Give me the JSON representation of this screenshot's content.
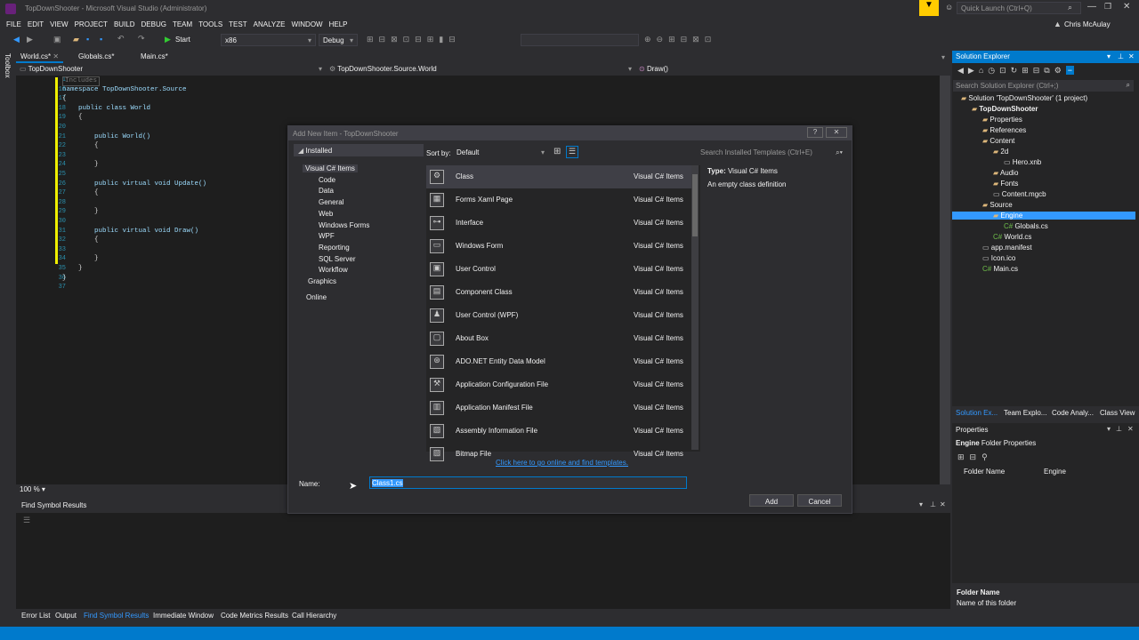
{
  "window": {
    "title": "TopDownShooter - Microsoft Visual Studio (Administrator)",
    "quick_launch": "Quick Launch (Ctrl+Q)",
    "user": "Chris McAulay"
  },
  "menu": [
    "FILE",
    "EDIT",
    "VIEW",
    "PROJECT",
    "BUILD",
    "DEBUG",
    "TEAM",
    "TOOLS",
    "TEST",
    "ANALYZE",
    "WINDOW",
    "HELP"
  ],
  "toolbar": {
    "start": "Start",
    "platform": "x86",
    "config": "Debug"
  },
  "editor": {
    "tabs": [
      "World.cs*",
      "Globals.cs*",
      "Main.cs*"
    ],
    "nav": {
      "project": "TopDownShooter",
      "class": "TopDownShooter.Source.World",
      "member": "Draw()"
    },
    "lines": [
      {
        "n": "1",
        "t": "Includes"
      },
      {
        "n": "16",
        "t": "namespace TopDownShooter.Source"
      },
      {
        "n": "17",
        "t": "{"
      },
      {
        "n": "18",
        "t": "    public class World"
      },
      {
        "n": "19",
        "t": "    {"
      },
      {
        "n": "20",
        "t": ""
      },
      {
        "n": "21",
        "t": "        public World()"
      },
      {
        "n": "22",
        "t": "        {"
      },
      {
        "n": "23",
        "t": ""
      },
      {
        "n": "24",
        "t": "        }"
      },
      {
        "n": "25",
        "t": ""
      },
      {
        "n": "26",
        "t": "        public virtual void Update()"
      },
      {
        "n": "27",
        "t": "        {"
      },
      {
        "n": "28",
        "t": ""
      },
      {
        "n": "29",
        "t": "        }"
      },
      {
        "n": "30",
        "t": ""
      },
      {
        "n": "31",
        "t": "        public virtual void Draw()"
      },
      {
        "n": "32",
        "t": "        {"
      },
      {
        "n": "33",
        "t": ""
      },
      {
        "n": "34",
        "t": "        }"
      },
      {
        "n": "35",
        "t": "    }"
      },
      {
        "n": "36",
        "t": "}"
      },
      {
        "n": "37",
        "t": ""
      }
    ],
    "zoom": "100 %"
  },
  "find_results": {
    "title": "Find Symbol Results"
  },
  "bottom_tabs": [
    "Error List",
    "Output",
    "Find Symbol Results",
    "Immediate Window",
    "Code Metrics Results",
    "Call Hierarchy"
  ],
  "solution_explorer": {
    "title": "Solution Explorer",
    "search": "Search Solution Explorer (Ctrl+;)",
    "items": [
      {
        "label": "Solution 'TopDownShooter' (1 project)",
        "indent": 0
      },
      {
        "label": "TopDownShooter",
        "indent": 1
      },
      {
        "label": "Properties",
        "indent": 2
      },
      {
        "label": "References",
        "indent": 2
      },
      {
        "label": "Content",
        "indent": 2
      },
      {
        "label": "2d",
        "indent": 3
      },
      {
        "label": "Hero.xnb",
        "indent": 4
      },
      {
        "label": "Audio",
        "indent": 3
      },
      {
        "label": "Fonts",
        "indent": 3
      },
      {
        "label": "Content.mgcb",
        "indent": 3
      },
      {
        "label": "Source",
        "indent": 2
      },
      {
        "label": "Engine",
        "indent": 3
      },
      {
        "label": "Globals.cs",
        "indent": 4
      },
      {
        "label": "World.cs",
        "indent": 3
      },
      {
        "label": "app.manifest",
        "indent": 2
      },
      {
        "label": "Icon.ico",
        "indent": 2
      },
      {
        "label": "Main.cs",
        "indent": 2
      }
    ],
    "bottom_tabs": [
      "Solution Ex...",
      "Team Explo...",
      "Code Analy...",
      "Class View"
    ]
  },
  "properties": {
    "title": "Properties",
    "subject": "Engine",
    "subject_type": "Folder Properties",
    "row_key": "Folder Name",
    "row_value": "Engine",
    "desc_title": "Folder Name",
    "desc_text": "Name of this folder"
  },
  "dialog": {
    "title": "Add New Item - TopDownShooter",
    "installed": "Installed",
    "tree": [
      {
        "label": "Visual C# Items",
        "indent": 1
      },
      {
        "label": "Code",
        "indent": 2
      },
      {
        "label": "Data",
        "indent": 2
      },
      {
        "label": "General",
        "indent": 2
      },
      {
        "label": "Web",
        "indent": 2
      },
      {
        "label": "Windows Forms",
        "indent": 2
      },
      {
        "label": "WPF",
        "indent": 2
      },
      {
        "label": "Reporting",
        "indent": 2
      },
      {
        "label": "SQL Server",
        "indent": 2
      },
      {
        "label": "Workflow",
        "indent": 2
      },
      {
        "label": "Graphics",
        "indent": 1
      }
    ],
    "online": "Online",
    "sort_label": "Sort by:",
    "sort_value": "Default",
    "search_placeholder": "Search Installed Templates (Ctrl+E)",
    "items": [
      {
        "name": "Class",
        "cat": "Visual C# Items"
      },
      {
        "name": "Forms Xaml Page",
        "cat": "Visual C# Items"
      },
      {
        "name": "Interface",
        "cat": "Visual C# Items"
      },
      {
        "name": "Windows Form",
        "cat": "Visual C# Items"
      },
      {
        "name": "User Control",
        "cat": "Visual C# Items"
      },
      {
        "name": "Component Class",
        "cat": "Visual C# Items"
      },
      {
        "name": "User Control (WPF)",
        "cat": "Visual C# Items"
      },
      {
        "name": "About Box",
        "cat": "Visual C# Items"
      },
      {
        "name": "ADO.NET Entity Data Model",
        "cat": "Visual C# Items"
      },
      {
        "name": "Application Configuration File",
        "cat": "Visual C# Items"
      },
      {
        "name": "Application Manifest File",
        "cat": "Visual C# Items"
      },
      {
        "name": "Assembly Information File",
        "cat": "Visual C# Items"
      },
      {
        "name": "Bitmap File",
        "cat": "Visual C# Items"
      }
    ],
    "type_label": "Type:",
    "type_value": "Visual C# Items",
    "description": "An empty class definition",
    "online_link": "Click here to go online and find templates.",
    "name_label": "Name:",
    "name_value": "Class1.cs",
    "add": "Add",
    "cancel": "Cancel"
  },
  "colors": {
    "accent": "#007acc",
    "bg": "#2d2d30",
    "editor": "#1e1e1e"
  }
}
